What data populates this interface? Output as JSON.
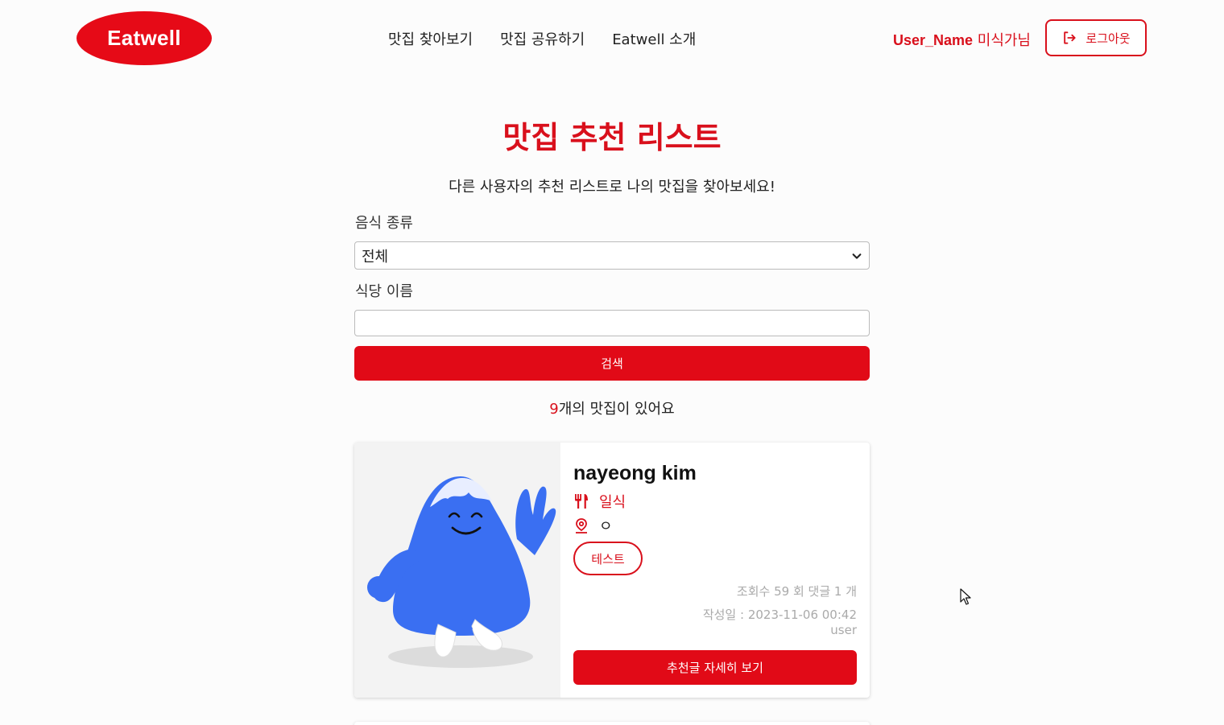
{
  "header": {
    "logo": "Eatwell",
    "nav": [
      "맛집 찾아보기",
      "맛집 공유하기",
      "Eatwell 소개"
    ],
    "user_name": "User_Name",
    "user_suffix": " 미식가님",
    "logout_label": "로그아웃"
  },
  "main": {
    "title": "맛집 추천 리스트",
    "subtitle": "다른 사용자의 추천 리스트로 나의 맛집을 찾아보세요!",
    "food_type_label": "음식 종류",
    "food_type_value": "전체",
    "restaurant_name_label": "식당 이름",
    "restaurant_name_value": "",
    "search_label": "검색",
    "count_number": "9",
    "count_text": "개의 맛집이 있어요"
  },
  "card": {
    "author": "nayeong kim",
    "cuisine": "일식",
    "location": "ㅇ",
    "tag": "테스트",
    "stats": "조회수 59 회  댓글 1 개",
    "date": "작성일 : 2023-11-06 00:42",
    "username": "user",
    "detail_label": "추천글 자세히 보기"
  },
  "colors": {
    "brand": "#e60a17",
    "brand_text": "#d9101c",
    "mascot": "#3a6ff2"
  },
  "icons": [
    "logout-icon",
    "chevron-down-icon",
    "fork-knife-icon",
    "map-pin-icon",
    "mouse-cursor-icon"
  ]
}
